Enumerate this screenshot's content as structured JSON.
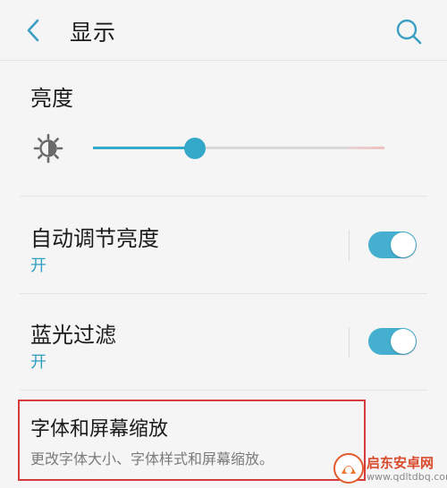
{
  "header": {
    "title": "显示",
    "back_icon": "chevron-left-icon",
    "search_icon": "search-icon"
  },
  "brightness": {
    "label": "亮度",
    "icon": "sun-icon",
    "level": 0.35
  },
  "auto_brightness": {
    "title": "自动调节亮度",
    "status": "开",
    "enabled": true
  },
  "blue_light_filter": {
    "title": "蓝光过滤",
    "status": "开",
    "enabled": true
  },
  "font_scaling": {
    "title": "字体和屏幕缩放",
    "description": "更改字体大小、字体样式和屏幕缩放。"
  },
  "watermark": {
    "brand": "启东安卓网",
    "url": "www.qdltdbq.com"
  },
  "colors": {
    "accent": "#34a8c9",
    "toggle_on": "#45afd0",
    "highlight": "#d63a3a"
  }
}
